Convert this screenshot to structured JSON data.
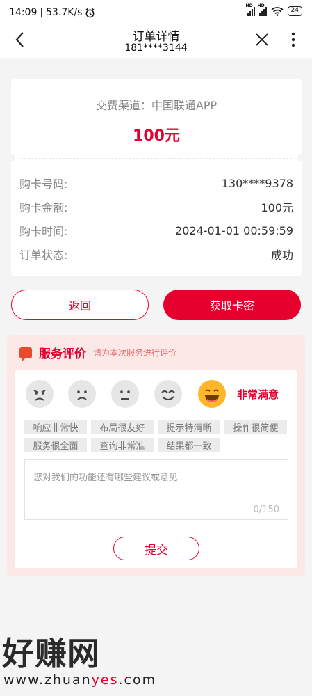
{
  "status": {
    "time": "14:09",
    "speed": "53.7K/s",
    "battery": "24"
  },
  "nav": {
    "title": "订单详情",
    "subtitle": "181****3144"
  },
  "order": {
    "channel": "交费渠道：中国联通APP",
    "amount": "100元",
    "rows": [
      {
        "label": "购卡号码:",
        "value": "130****9378"
      },
      {
        "label": "购卡金额:",
        "value": "100元"
      },
      {
        "label": "购卡时间:",
        "value": "2024-01-01 00:59:59"
      },
      {
        "label": "订单状态:",
        "value": "成功"
      }
    ]
  },
  "actions": {
    "back": "返回",
    "get": "获取卡密"
  },
  "eval": {
    "title": "服务评价",
    "subtitle": "请为本次服务进行评价",
    "faces": [
      "angry",
      "sad",
      "neutral",
      "smile",
      "very-happy"
    ],
    "selected_mood": "非常满意",
    "tags": [
      "响应非常快",
      "布局很友好",
      "提示特清晰",
      "操作很简便",
      "服务很全面",
      "查询非常准",
      "结果都一致"
    ],
    "placeholder": "您对我们的功能还有哪些建议或意见",
    "counter": "0/150",
    "submit": "提交"
  },
  "watermark": {
    "logo": "好赚网",
    "url_pre": "www.zhuan",
    "url_hl": "yes",
    "url_post": ".com"
  },
  "colors": {
    "accent": "#e5002d",
    "background": "#f4f4f4",
    "face_active": "#ffb628"
  }
}
